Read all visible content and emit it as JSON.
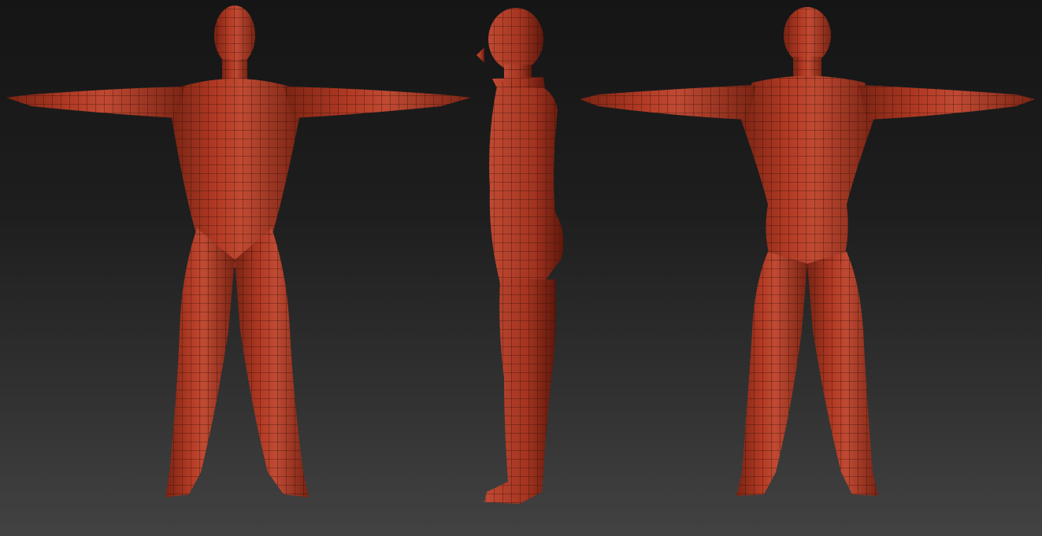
{
  "scene": {
    "background_top": "#151515",
    "background_bottom": "#424242",
    "mesh_color": "#a8321f",
    "mesh_highlight": "#c8553c",
    "mesh_shadow": "#6b1c10",
    "wire_color": "#2a0c06",
    "views": [
      {
        "id": "front",
        "icon": "human-front-view"
      },
      {
        "id": "side",
        "icon": "human-side-view"
      },
      {
        "id": "back",
        "icon": "human-back-view"
      }
    ]
  }
}
